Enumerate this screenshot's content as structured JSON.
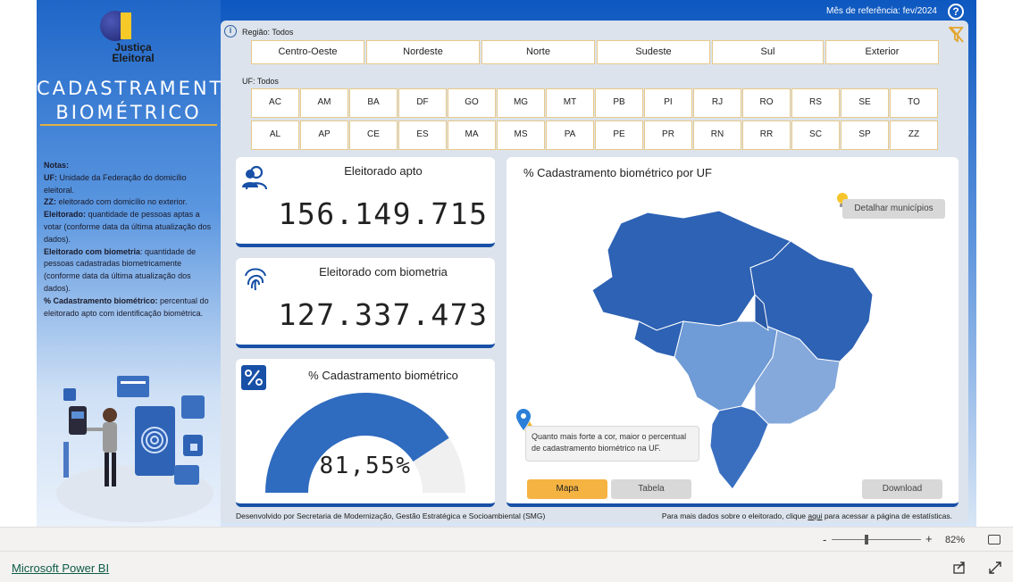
{
  "brand": {
    "logo_line1": "Justiça",
    "logo_line2": "Eleitoral"
  },
  "title": {
    "line1": "CADASTRAMENTO",
    "line2": "BIOMÉTRICO"
  },
  "header": {
    "month_ref": "Mês de referência: fev/2024",
    "help": "?"
  },
  "notes": {
    "heading": "Notas:",
    "items": [
      {
        "term": "UF:",
        "text": " Unidade da Federação do domicílio eleitoral."
      },
      {
        "term": "ZZ:",
        "text": " eleitorado com domicílio no exterior."
      },
      {
        "term": "Eleitorado:",
        "text": " quantidade de pessoas aptas a votar (conforme data da última atualização dos dados)."
      },
      {
        "term": "Eleitorado com biometria",
        "text": ": quantidade de pessoas cadastradas biometricamente (conforme data da última atualização dos dados)."
      },
      {
        "term": "% Cadastramento biométrico:",
        "text": " percentual do eleitorado apto com identificação biométrica."
      }
    ]
  },
  "filters": {
    "region_label": "Região: Todos",
    "info": "i",
    "regions": [
      "Centro-Oeste",
      "Nordeste",
      "Norte",
      "Sudeste",
      "Sul",
      "Exterior"
    ],
    "uf_label": "UF: Todos",
    "ufs_row1": [
      "AC",
      "AM",
      "BA",
      "DF",
      "GO",
      "MG",
      "MT",
      "PB",
      "PI",
      "RJ",
      "RO",
      "RS",
      "SE",
      "TO"
    ],
    "ufs_row2": [
      "AL",
      "AP",
      "CE",
      "ES",
      "MA",
      "MS",
      "PA",
      "PE",
      "PR",
      "RN",
      "RR",
      "SC",
      "SP",
      "ZZ"
    ]
  },
  "kpis": {
    "eleitorado_title": "Eleitorado apto",
    "eleitorado_value": "156.149.715",
    "biometria_title": "Eleitorado com biometria",
    "biometria_value": "127.337.473",
    "percent_title": "% Cadastramento biométrico",
    "percent_value": "81,55%",
    "percent_fraction": 0.8155
  },
  "map": {
    "title": "% Cadastramento biométrico por UF",
    "detail_button": "Detalhar municípios",
    "tip": "Quanto mais forte a cor, maior o percentual de cadastramento biométrico na UF.",
    "tab_map": "Mapa",
    "tab_table": "Tabela",
    "download": "Download"
  },
  "footer": {
    "left": "Desenvolvido por Secretaria de Modernização, Gestão Estratégica e Socioambiental (SMG)",
    "right_prefix": "Para mais dados sobre o eleitorado, clique ",
    "right_link": "aqui",
    "right_suffix": " para acessar a página de estatísticas."
  },
  "zoom": {
    "minus": "-",
    "plus": "+",
    "percent": "82%"
  },
  "bottom": {
    "powerbi": "Microsoft Power BI"
  },
  "colors": {
    "accent_blue": "#1750a6",
    "gold": "#e8c98a",
    "tab_active": "#f5b342",
    "map_dark": "#2d62b4",
    "map_light": "#6f9bd6"
  }
}
